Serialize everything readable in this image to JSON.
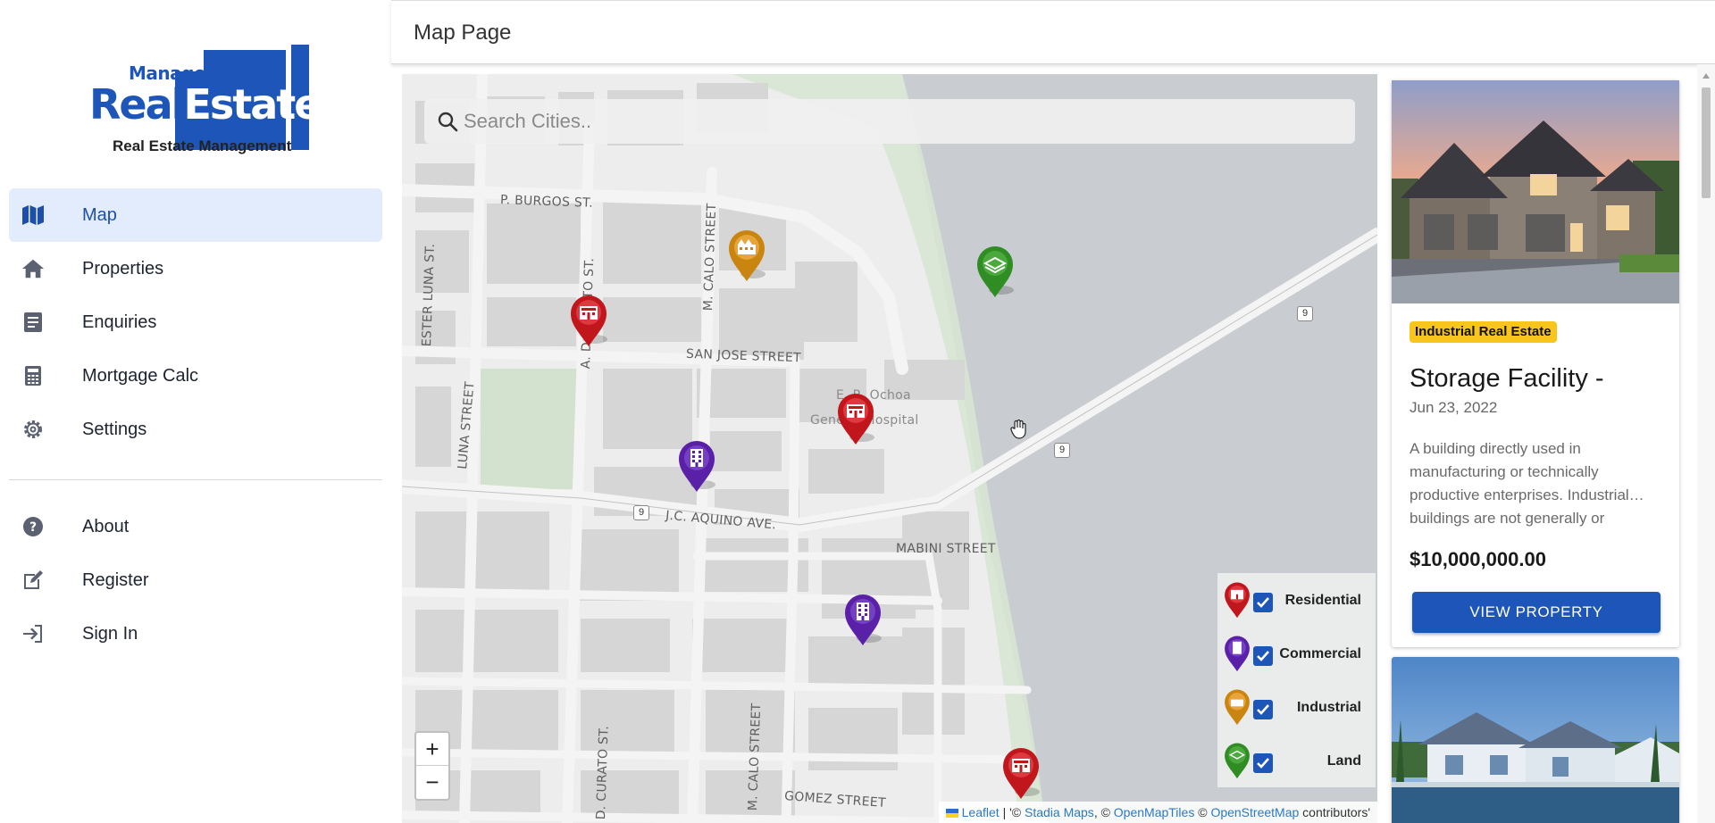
{
  "app": {
    "logo_top_word": "Management",
    "logo_main_word_a": "Real",
    "logo_main_word_b": "Estate",
    "logo_tagline": "Real Estate Management"
  },
  "sidebar": {
    "items": [
      {
        "label": "Map",
        "icon": "map-icon",
        "active": true
      },
      {
        "label": "Properties",
        "icon": "home-icon"
      },
      {
        "label": "Enquiries",
        "icon": "document-icon"
      },
      {
        "label": "Mortgage Calc",
        "icon": "calculator-icon"
      },
      {
        "label": "Settings",
        "icon": "gear-icon"
      }
    ],
    "secondary": [
      {
        "label": "About",
        "icon": "help-icon"
      },
      {
        "label": "Register",
        "icon": "edit-icon"
      },
      {
        "label": "Sign In",
        "icon": "sign-in-icon"
      }
    ]
  },
  "header": {
    "title": "Map Page"
  },
  "map": {
    "search_placeholder": "Search Cities..",
    "streets": {
      "p_burgos": "P. BURGOS ST.",
      "ester_luna": "ESTER LUNA ST.",
      "curato_top": "A. D. CURATO ST.",
      "calo_top": "M. CALO STREET",
      "san_jose": "SAN JOSE STREET",
      "luna": "LUNA STREET",
      "hospital_a": "E. R. Ochoa",
      "hospital_b": "General Hospital",
      "aquino": "J.C. AQUINO AVE.",
      "mabini": "MABINI STREET",
      "calo_bottom": "M. CALO STREET",
      "curato_bottom": "D. CURATO ST.",
      "gomez": "GOMEZ STREET"
    },
    "route_shield": "9",
    "zoom_in": "+",
    "zoom_out": "−",
    "legend": [
      {
        "label": "Residential",
        "color": "#c0161c",
        "checked": true
      },
      {
        "label": "Commercial",
        "color": "#5a21a8",
        "checked": true
      },
      {
        "label": "Industrial",
        "color": "#c9850f",
        "checked": true
      },
      {
        "label": "Land",
        "color": "#2f8d23",
        "checked": true
      }
    ],
    "attribution": {
      "leaflet": "Leaflet",
      "sep1": " | '© ",
      "stadia": "Stadia Maps",
      "sep2": ", © ",
      "omt": "OpenMapTiles",
      "sep3": " © ",
      "osm": "OpenStreetMap",
      "tail": " contributors'"
    }
  },
  "listing": {
    "badge": "Industrial Real Estate",
    "title": "Storage Facility -",
    "date": "Jun 23, 2022",
    "description": "A building directly used in manufacturing or technically productive enterprises. Industrial… buildings are not generally or",
    "price": "$10,000,000.00",
    "button": "VIEW PROPERTY"
  },
  "colors": {
    "primary": "#1d56b8",
    "active_bg": "#e3ecfd",
    "badge": "#f7c51b",
    "residential": "#c0161c",
    "commercial": "#5a21a8",
    "industrial": "#c9850f",
    "land": "#2f8d23"
  }
}
